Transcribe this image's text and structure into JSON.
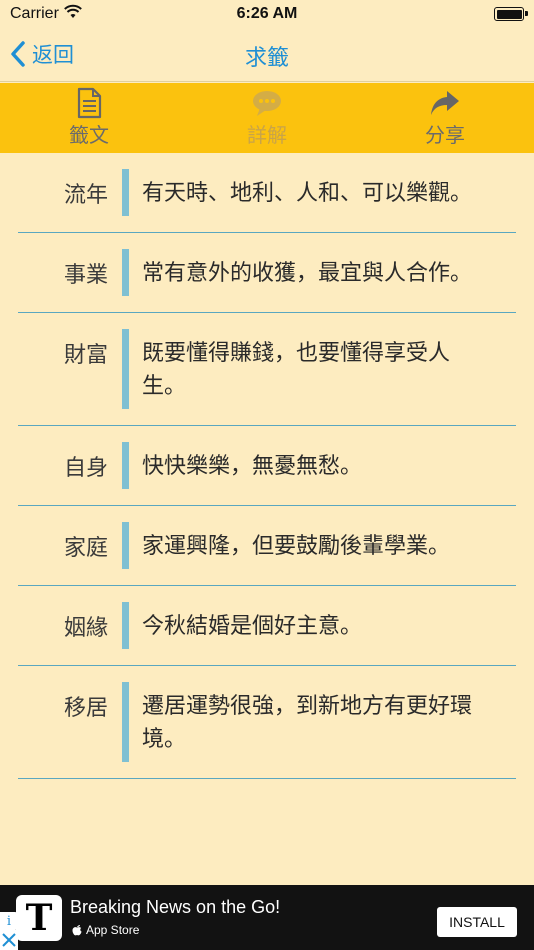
{
  "status_bar": {
    "carrier": "Carrier",
    "time": "6:26 AM"
  },
  "nav": {
    "back_label": "返回",
    "title": "求籤"
  },
  "toolbar": {
    "items": [
      {
        "label": "籤文",
        "icon": "document-icon",
        "enabled": true
      },
      {
        "label": "詳解",
        "icon": "chat-bubble-icon",
        "enabled": false
      },
      {
        "label": "分享",
        "icon": "share-arrow-icon",
        "enabled": true
      }
    ]
  },
  "rows": [
    {
      "label": "流年",
      "text": "有天時、地利、人和、可以樂觀。"
    },
    {
      "label": "事業",
      "text": "常有意外的收獲，最宜與人合作。"
    },
    {
      "label": "財富",
      "text": "既要懂得賺錢，也要懂得享受人生。"
    },
    {
      "label": "自身",
      "text": "快快樂樂，無憂無愁。"
    },
    {
      "label": "家庭",
      "text": "家運興隆，但要鼓勵後輩學業。"
    },
    {
      "label": "姻緣",
      "text": "今秋結婚是個好主意。"
    },
    {
      "label": "移居",
      "text": "遷居運勢很強，到新地方有更好環境。"
    }
  ],
  "ad": {
    "title": "Breaking News on the Go!",
    "store": "App Store",
    "install_label": "INSTALL",
    "logo_letter": "T"
  },
  "colors": {
    "accent": "#1f8fd4",
    "toolbar": "#fbc20e",
    "background": "#fdecc0",
    "divider": "#5aa7c0"
  }
}
